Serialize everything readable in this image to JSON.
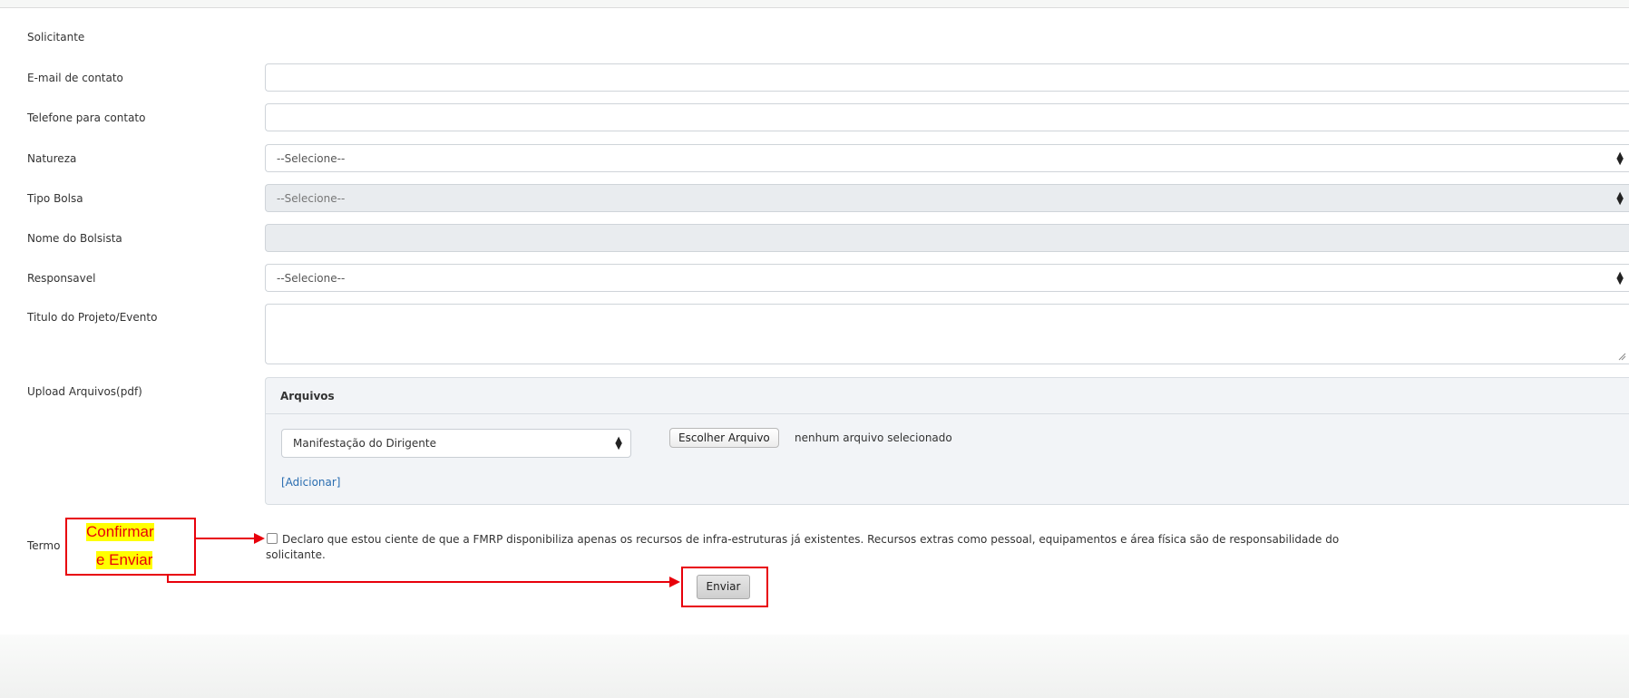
{
  "form": {
    "solicitante_label": "Solicitante",
    "email_label": "E-mail de contato",
    "email_value": "",
    "telefone_label": "Telefone para contato",
    "telefone_value": "",
    "natureza_label": "Natureza",
    "natureza_value": "--Selecione--",
    "tipo_bolsa_label": "Tipo Bolsa",
    "tipo_bolsa_value": "--Selecione--",
    "nome_bolsista_label": "Nome do Bolsista",
    "nome_bolsista_value": "",
    "responsavel_label": "Responsavel",
    "responsavel_value": "--Selecione--",
    "titulo_label": "Titulo do Projeto/Evento",
    "titulo_value": "",
    "upload_label": "Upload Arquivos(pdf)",
    "termo_label": "Termo"
  },
  "arquivos": {
    "header": "Arquivos",
    "file_type_value": "Manifestação do Dirigente",
    "choose_button": "Escolher Arquivo",
    "no_file_text": "nenhum arquivo selecionado",
    "add_link": "[Adicionar]"
  },
  "terms": {
    "line1": "Declaro que estou ciente de que a FMRP disponibiliza apenas os recursos de infra-estruturas já existentes. Recursos extras como pessoal, equipamentos e área física são de responsabilidade do",
    "line2": "solicitante.",
    "checked": false
  },
  "submit_label": "Enviar",
  "annotation": {
    "line1": "Confirmar",
    "line2": "e Enviar",
    "color": "#e8000b",
    "highlight": "#ffff00"
  },
  "icons": {
    "select_arrows": "updown-arrows-icon",
    "resize": "resize-grip-icon"
  }
}
